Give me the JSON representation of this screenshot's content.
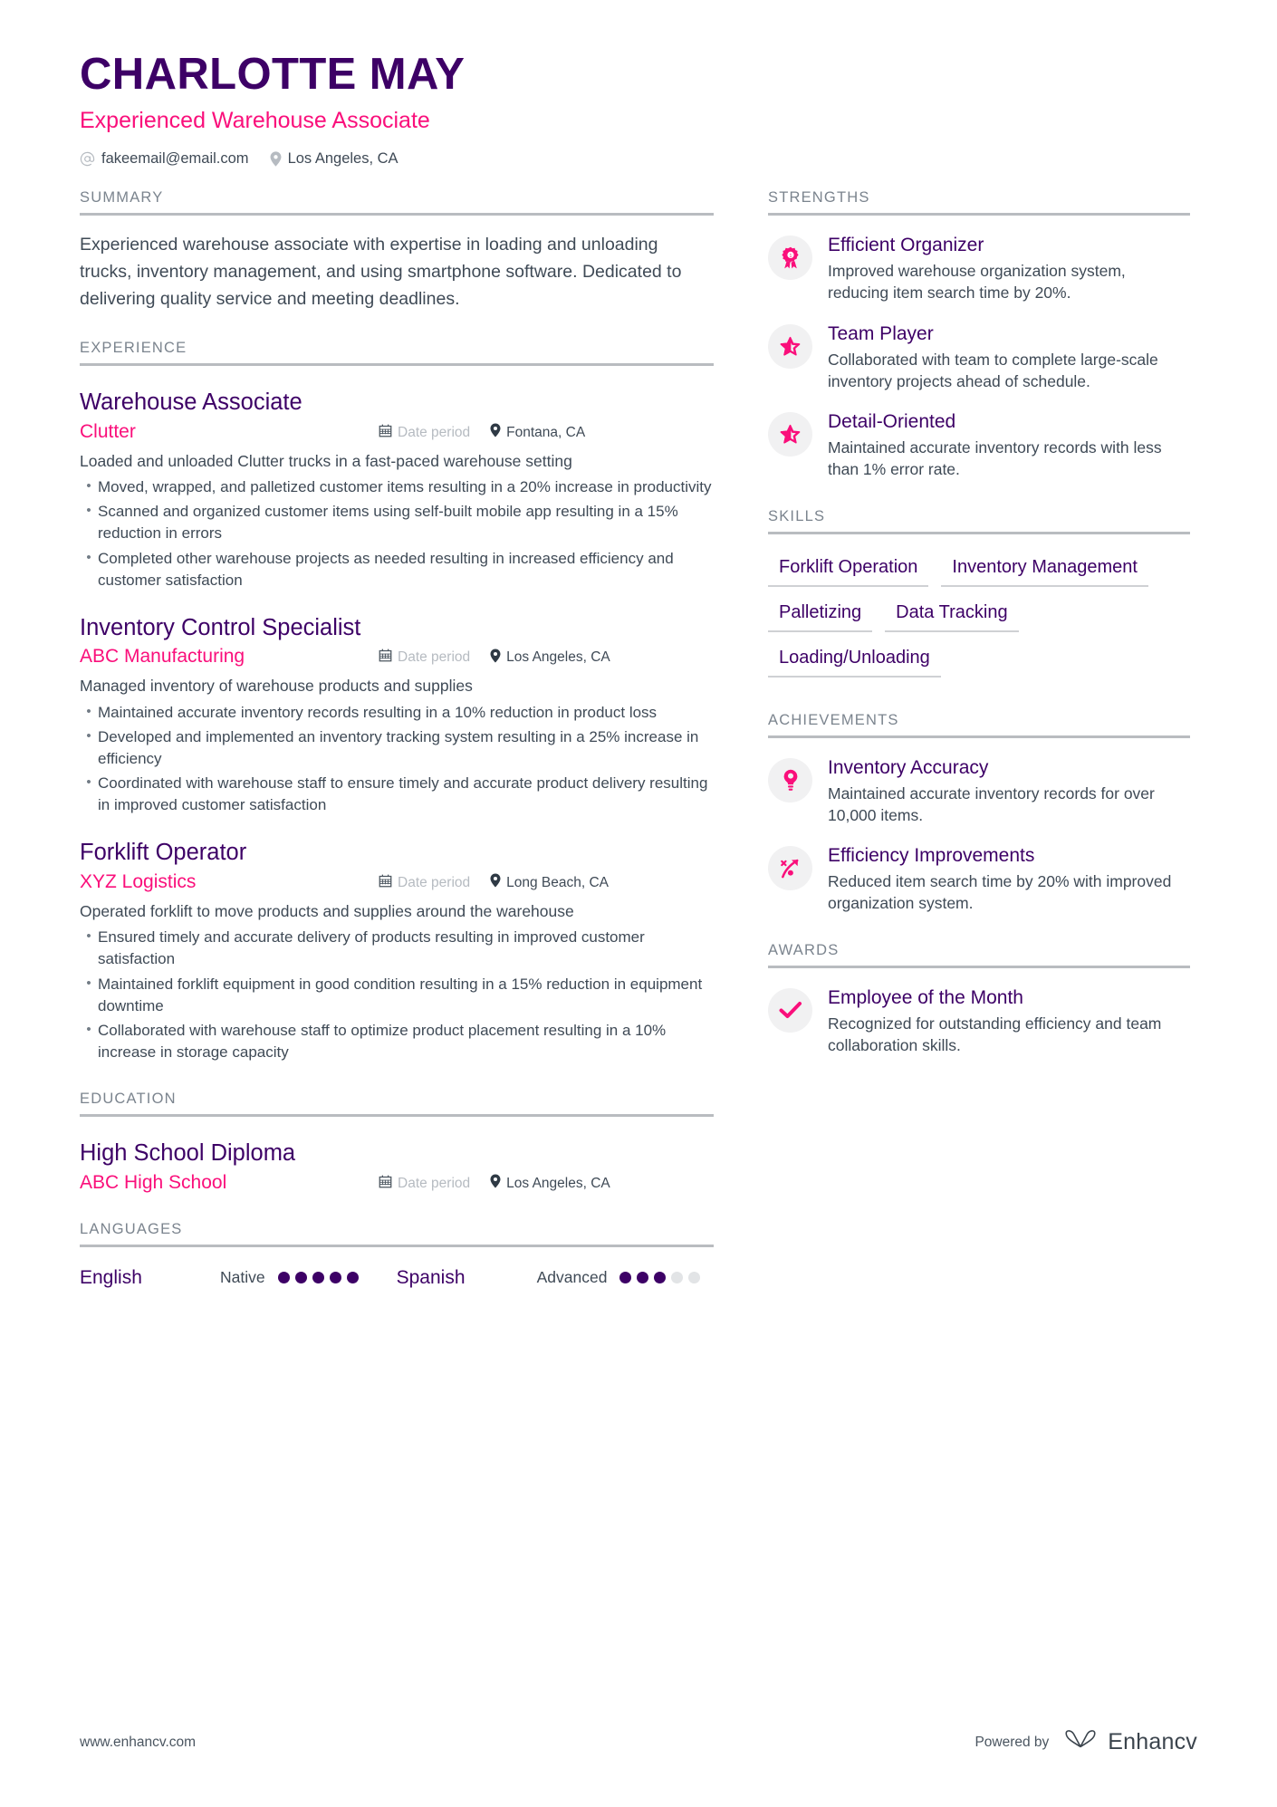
{
  "colors": {
    "primary_purple": "#3d0066",
    "accent_pink": "#fa0f7b",
    "body_text": "#3f4a56",
    "muted": "#7b848e",
    "rule": "#b9bcc0",
    "icon_bg": "#f1f1f2",
    "dot_off": "#e2e4e6"
  },
  "header": {
    "name": "CHARLOTTE MAY",
    "role": "Experienced Warehouse Associate",
    "email": "fakeemail@email.com",
    "location": "Los Angeles, CA",
    "email_icon": "at-sign-icon",
    "location_icon": "map-pin-icon"
  },
  "summary": {
    "heading": "SUMMARY",
    "text": "Experienced warehouse associate with expertise in loading and unloading trucks, inventory management, and using smartphone software. Dedicated to delivering quality service and meeting deadlines."
  },
  "experience": {
    "heading": "EXPERIENCE",
    "entries": [
      {
        "title": "Warehouse Associate",
        "company": "Clutter",
        "date": "Date period",
        "location": "Fontana, CA",
        "lead": "Loaded and unloaded Clutter trucks in a fast-paced warehouse setting",
        "bullets": [
          "Moved, wrapped, and palletized customer items resulting in a 20% increase in productivity",
          "Scanned and organized customer items using self-built mobile app resulting in a 15% reduction in errors",
          "Completed other warehouse projects as needed resulting in increased efficiency and customer satisfaction"
        ]
      },
      {
        "title": "Inventory Control Specialist",
        "company": "ABC Manufacturing",
        "date": "Date period",
        "location": "Los Angeles, CA",
        "lead": "Managed inventory of warehouse products and supplies",
        "bullets": [
          "Maintained accurate inventory records resulting in a 10% reduction in product loss",
          "Developed and implemented an inventory tracking system resulting in a 25% increase in efficiency",
          "Coordinated with warehouse staff to ensure timely and accurate product delivery resulting in improved customer satisfaction"
        ]
      },
      {
        "title": "Forklift Operator",
        "company": "XYZ Logistics",
        "date": "Date period",
        "location": "Long Beach, CA",
        "lead": "Operated forklift to move products and supplies around the warehouse",
        "bullets": [
          "Ensured timely and accurate delivery of products resulting in improved customer satisfaction",
          "Maintained forklift equipment in good condition resulting in a 15% reduction in equipment downtime",
          "Collaborated with warehouse staff to optimize product placement resulting in a 10% increase in storage capacity"
        ]
      }
    ]
  },
  "education": {
    "heading": "EDUCATION",
    "entries": [
      {
        "title": "High School Diploma",
        "company": "ABC High School",
        "date": "Date period",
        "location": "Los Angeles, CA"
      }
    ]
  },
  "languages": {
    "heading": "LANGUAGES",
    "items": [
      {
        "name": "English",
        "level": "Native",
        "filled": 5,
        "total": 5
      },
      {
        "name": "Spanish",
        "level": "Advanced",
        "filled": 3,
        "total": 5
      }
    ]
  },
  "strengths": {
    "heading": "STRENGTHS",
    "items": [
      {
        "icon": "award-ribbon-icon",
        "title": "Efficient Organizer",
        "desc": "Improved warehouse organization system, reducing item search time by 20%."
      },
      {
        "icon": "star-icon",
        "title": "Team Player",
        "desc": "Collaborated with team to complete large-scale inventory projects ahead of schedule."
      },
      {
        "icon": "star-icon",
        "title": "Detail-Oriented",
        "desc": "Maintained accurate inventory records with less than 1% error rate."
      }
    ]
  },
  "skills": {
    "heading": "SKILLS",
    "items": [
      "Forklift Operation",
      "Inventory Management",
      "Palletizing",
      "Data Tracking",
      "Loading/Unloading"
    ]
  },
  "achievements": {
    "heading": "ACHIEVEMENTS",
    "items": [
      {
        "icon": "lightbulb-icon",
        "title": "Inventory Accuracy",
        "desc": "Maintained accurate inventory records for over 10,000 items."
      },
      {
        "icon": "growth-arrow-icon",
        "title": "Efficiency Improvements",
        "desc": "Reduced item search time by 20% with improved organization system."
      }
    ]
  },
  "awards": {
    "heading": "AWARDS",
    "items": [
      {
        "icon": "check-icon",
        "title": "Employee of the Month",
        "desc": "Recognized for outstanding efficiency and team collaboration skills."
      }
    ]
  },
  "footer": {
    "url": "www.enhancv.com",
    "powered_by": "Powered by",
    "brand": "Enhancv",
    "brand_icon": "enhancv-logo-icon"
  }
}
